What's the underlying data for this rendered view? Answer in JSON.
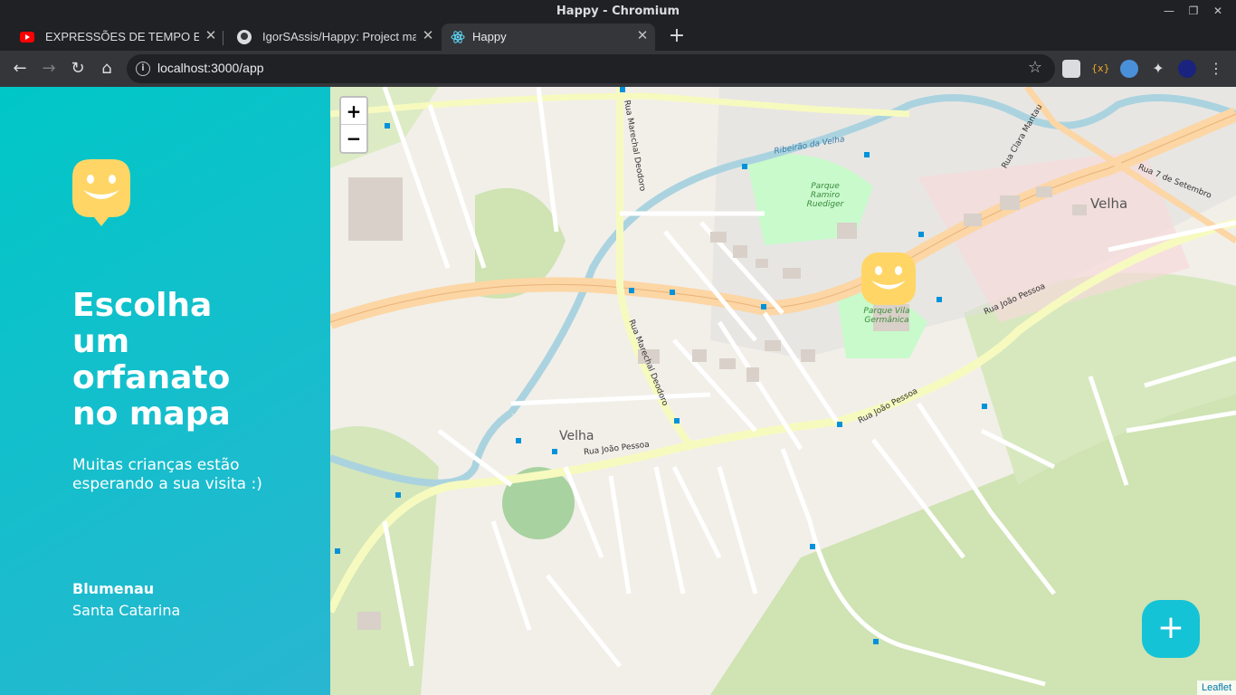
{
  "window": {
    "title": "Happy - Chromium"
  },
  "tabs": [
    {
      "label": "EXPRESSÕES DE TEMPO EM IN",
      "favicon": "youtube-icon"
    },
    {
      "label": "IgorSAssis/Happy: Project ma",
      "favicon": "github-icon"
    },
    {
      "label": "Happy",
      "favicon": "react-icon",
      "active": true
    }
  ],
  "toolbar": {
    "url": "localhost:3000/app"
  },
  "sidebar": {
    "headline": "Escolha um orfanato no mapa",
    "subtitle": "Muitas crianças estão esperando a sua visita :)",
    "city": "Blumenau",
    "state": "Santa Catarina"
  },
  "map": {
    "zoom_in": "+",
    "zoom_out": "−",
    "attribution": "Leaflet",
    "labels": {
      "park1": "Parque Ramiro Ruediger",
      "park2": "Parque Vila Germânica",
      "district": "Velha",
      "river": "Ribeirão da Velha",
      "street1": "Rua João Pessoa",
      "street2": "Rua Marechal Deodoro",
      "street3": "Rua 7 de Setembro",
      "street4": "Rua Clara Mantau"
    },
    "add_button": "+"
  },
  "colors": {
    "brand_gradient_start": "#29b6d1",
    "brand_gradient_end": "#00c7c7",
    "marker": "#ffd666",
    "fab": "#15c3d6"
  }
}
